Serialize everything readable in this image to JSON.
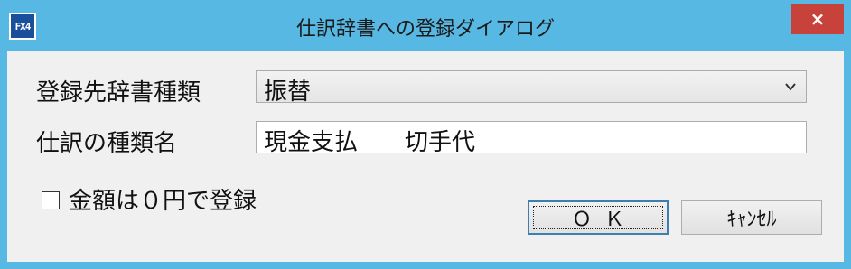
{
  "window": {
    "title": "仕訳辞書への登録ダイアログ",
    "app_icon_text": "FX4",
    "close_glyph": "×",
    "accent_color": "#57b8e3",
    "close_color": "#c7423a"
  },
  "form": {
    "dictionary_type_label": "登録先辞書種類",
    "dictionary_type_value": "振替",
    "entry_type_name_label": "仕訳の種類名",
    "entry_type_name_value": "現金支払　　切手代",
    "zero_amount_checkbox_label": "金額は０円で登録",
    "zero_amount_checked": false
  },
  "buttons": {
    "ok_label": "ＯＫ",
    "cancel_label": "ｷｬﾝｾﾙ"
  }
}
